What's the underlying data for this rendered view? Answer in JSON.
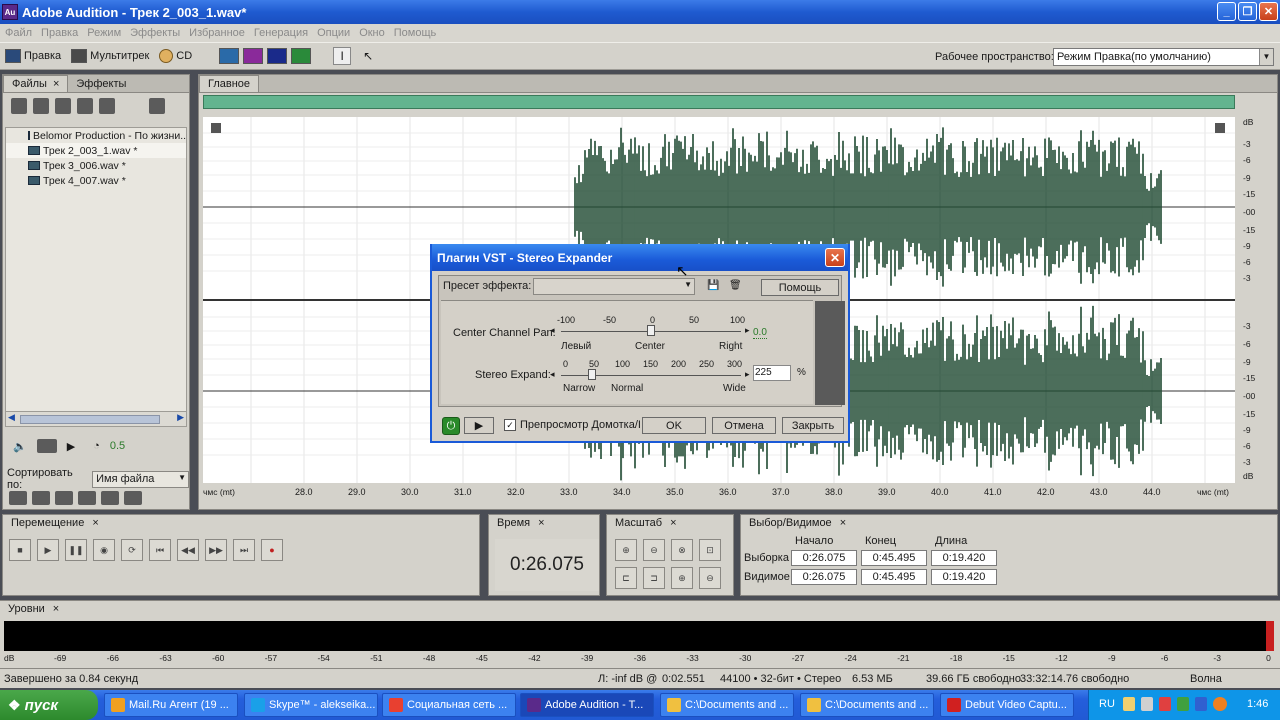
{
  "window": {
    "app_icon": "Au",
    "title": "Adobe Audition - Трек 2_003_1.wav*"
  },
  "menu": [
    "Файл",
    "Правка",
    "Режим",
    "Эффекты",
    "Избранное",
    "Генерация",
    "Опции",
    "Окно",
    "Помощь"
  ],
  "toolbar": {
    "edit_label": "Правка",
    "multitrack_label": "Мультитрек",
    "cd_label": "CD",
    "workspace_label": "Рабочее пространство:",
    "workspace_value": "Режим Правка(по умолчанию)"
  },
  "left_panel": {
    "tabs": [
      "Файлы",
      "Эффекты"
    ],
    "files": [
      {
        "name": "Belomor Production - По жизни...",
        "selected": false
      },
      {
        "name": "Трек 2_003_1.wav *",
        "selected": true
      },
      {
        "name": "Трек 3_006.wav *",
        "selected": false
      },
      {
        "name": "Трек 4_007.wav *",
        "selected": false
      }
    ],
    "volume": "0.5",
    "sort_label": "Сортировать по:",
    "sort_value": "Имя файла"
  },
  "main": {
    "tab": "Главное",
    "db_top": [
      "dB",
      "-3",
      "-6",
      "-9",
      "-15",
      "-00",
      "-15",
      "-9",
      "-6",
      "-3"
    ],
    "db_bottom": [
      "-3",
      "-6",
      "-9",
      "-15",
      "-00",
      "-15",
      "-9",
      "-6",
      "-3",
      "dB"
    ],
    "time_unit": "чмс (mt)",
    "time_ticks": [
      "28.0",
      "29.0",
      "30.0",
      "31.0",
      "32.0",
      "33.0",
      "34.0",
      "35.0",
      "36.0",
      "37.0",
      "38.0",
      "39.0",
      "40.0",
      "41.0",
      "42.0",
      "43.0",
      "44.0"
    ]
  },
  "dialog": {
    "title": "Плагин VST - Stereo Expander",
    "preset_label": "Пресет эффекта:",
    "help_button": "Помощь",
    "center_label": "Center Channel Pan:",
    "center_ticks": [
      "-100",
      "-50",
      "0",
      "50",
      "100"
    ],
    "center_value": "0.0",
    "center_left": "Левый",
    "center_mid": "Center",
    "center_right": "Right",
    "expand_label": "Stereo Expand:",
    "expand_ticks": [
      "0",
      "50",
      "100",
      "150",
      "200",
      "250",
      "300"
    ],
    "expand_value": "225",
    "expand_unit": "%",
    "expand_narrow": "Narrow",
    "expand_normal": "Normal",
    "expand_wide": "Wide",
    "preview_label": "Препросмотр Домотка/I",
    "ok": "OK",
    "cancel": "Отмена",
    "close": "Закрыть"
  },
  "transport": {
    "tab": "Перемещение"
  },
  "time": {
    "tab": "Время",
    "value": "0:26.075"
  },
  "zoom": {
    "tab": "Масштаб"
  },
  "selection": {
    "tab": "Выбор/Видимое",
    "headers": [
      "Начало",
      "Конец",
      "Длина"
    ],
    "row1_label": "Выборка",
    "row1": [
      "0:26.075",
      "0:45.495",
      "0:19.420"
    ],
    "row2_label": "Видимое",
    "row2": [
      "0:26.075",
      "0:45.495",
      "0:19.420"
    ]
  },
  "levels": {
    "tab": "Уровни",
    "scale": [
      "dB",
      "-69",
      "-66",
      "-63",
      "-60",
      "-57",
      "-54",
      "-51",
      "-48",
      "-45",
      "-42",
      "-39",
      "-36",
      "-33",
      "-30",
      "-27",
      "-24",
      "-21",
      "-18",
      "-15",
      "-12",
      "-9",
      "-6",
      "-3",
      "0"
    ]
  },
  "status": {
    "left": "Завершено за 0.84 секунд",
    "level": "Л: -inf dB @",
    "pos": "0:02.551",
    "format": "44100 • 32-бит • Стерео",
    "size": "6.53 МБ",
    "free": "39.66 ГБ свободно",
    "free_time": "33:32:14.76 свободно",
    "mode": "Волна"
  },
  "taskbar": {
    "start": "пуск",
    "tasks": [
      {
        "label": "Mail.Ru Агент (19 ...",
        "icon": "mail-icon",
        "color": "#f0a020"
      },
      {
        "label": "Skype™ - alekseika...",
        "icon": "skype-icon",
        "color": "#1aa0e8"
      },
      {
        "label": "Социальная сеть ...",
        "icon": "chrome-icon",
        "color": "#e84030"
      },
      {
        "label": "Adobe Audition - T...",
        "icon": "audition-icon",
        "color": "#5a2a8a"
      },
      {
        "label": "C:\\Documents and ...",
        "icon": "folder-icon",
        "color": "#f0c040"
      },
      {
        "label": "C:\\Documents and ...",
        "icon": "folder-icon",
        "color": "#f0c040"
      },
      {
        "label": "Debut Video Captu...",
        "icon": "debut-icon",
        "color": "#d02020"
      }
    ],
    "lang": "RU",
    "clock": "1:46"
  }
}
